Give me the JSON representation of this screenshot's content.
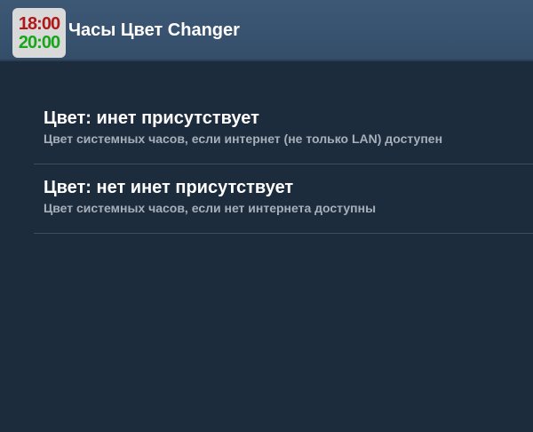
{
  "action_bar": {
    "icon_time_top": "18:00",
    "icon_time_bottom": "20:00",
    "title": "Часы Цвет Changer"
  },
  "preferences": [
    {
      "title": "Цвет: инет присутствует",
      "summary": "Цвет системных часов, если интернет (не только LAN) доступен"
    },
    {
      "title": "Цвет: нет инет присутствует",
      "summary": "Цвет системных часов, если нет интернета доступны"
    }
  ],
  "colors": {
    "background": "#1d2c3d",
    "action_bar": "#3a5471",
    "icon_time_top": "#b01818",
    "icon_time_bottom": "#17a61a"
  }
}
